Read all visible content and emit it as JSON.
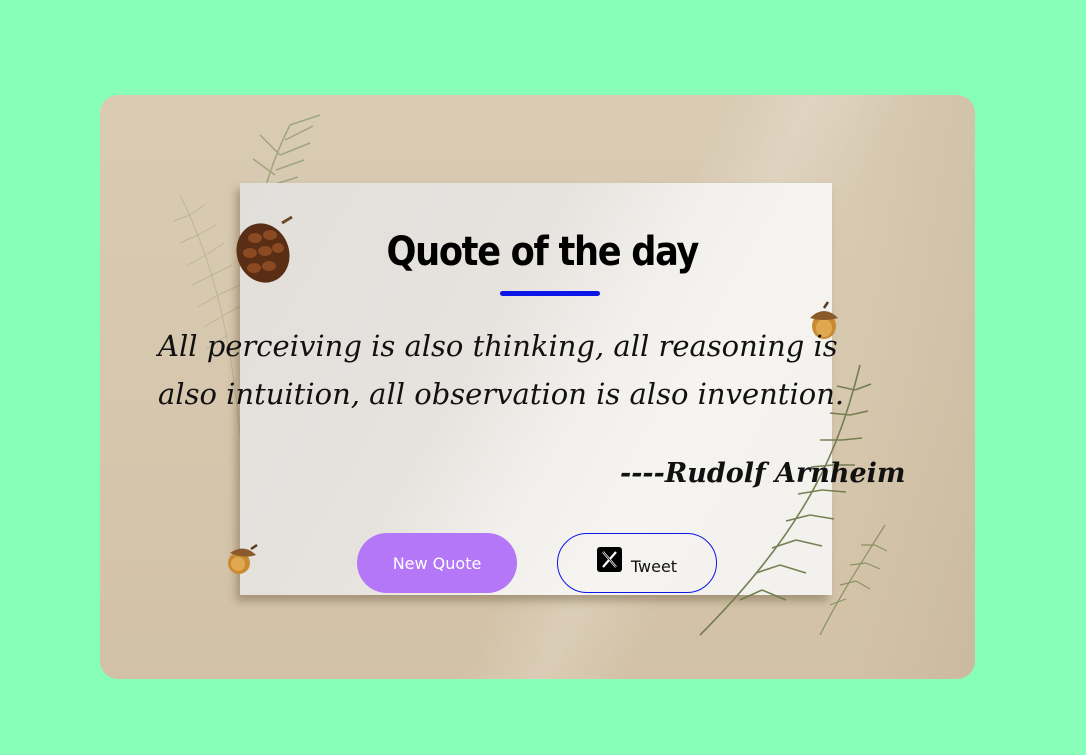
{
  "page": {
    "background_color": "#87ffb9",
    "accent_color": "#0d16e8",
    "button_color": "#b477f7"
  },
  "card": {
    "title": "Quote of the day",
    "quote": "All perceiving is also thinking, all reasoning is also intuition, all observation is also invention.",
    "author": "----Rudolf Arnheim"
  },
  "actions": {
    "new_quote_label": "New Quote",
    "tweet_label": "Tweet",
    "tweet_icon": "x-logo-icon"
  },
  "decorations": {
    "icons": [
      "pinecone-icon",
      "acorn-icon",
      "fern-leaf-icon"
    ]
  }
}
